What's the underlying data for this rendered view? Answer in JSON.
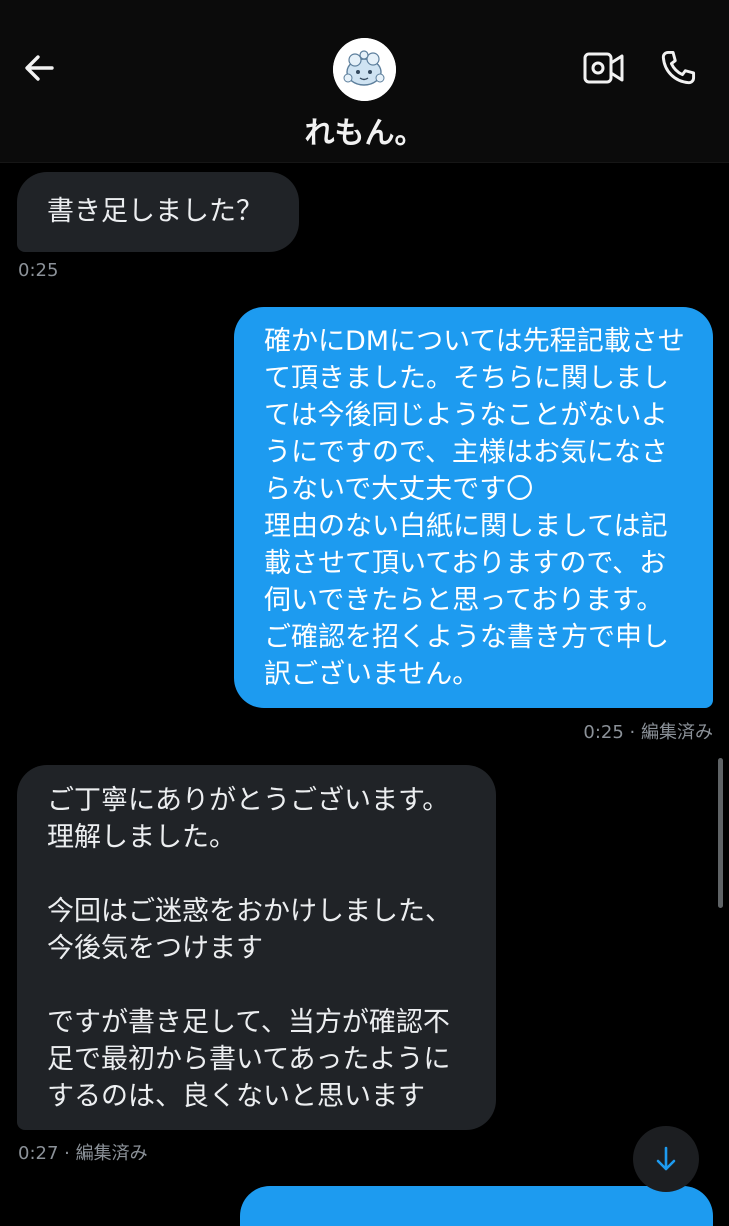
{
  "header": {
    "contact_name": "れもん。",
    "back_icon": "back-arrow-icon",
    "video_icon": "video-camera-icon",
    "call_icon": "phone-icon"
  },
  "messages": [
    {
      "direction": "in",
      "text": "書き足しました？",
      "meta": "0:25"
    },
    {
      "direction": "out",
      "text": "確かにDMについては先程記載させて頂きました。そちらに関しましては今後同じようなことがないようにですので、主様はお気になさらないで大丈夫です〇\n理由のない白紙に関しましては記載させて頂いておりますので、お伺いできたらと思っております。ご確認を招くような書き方で申し訳ございません。",
      "meta": "0:25 · 編集済み"
    },
    {
      "direction": "in",
      "text": "ご丁寧にありがとうございます。\n理解しました。\n\n今回はご迷惑をおかけしました、\n今後気をつけます\n\nですが書き足して、当方が確認不足で最初から書いてあったようにするのは、良くないと思います",
      "meta": "0:27 · 編集済み"
    }
  ],
  "colors": {
    "outgoing": "#1d9bf0",
    "incoming": "#202327",
    "background": "#000000"
  },
  "scroll_down_icon": "arrow-down-icon"
}
